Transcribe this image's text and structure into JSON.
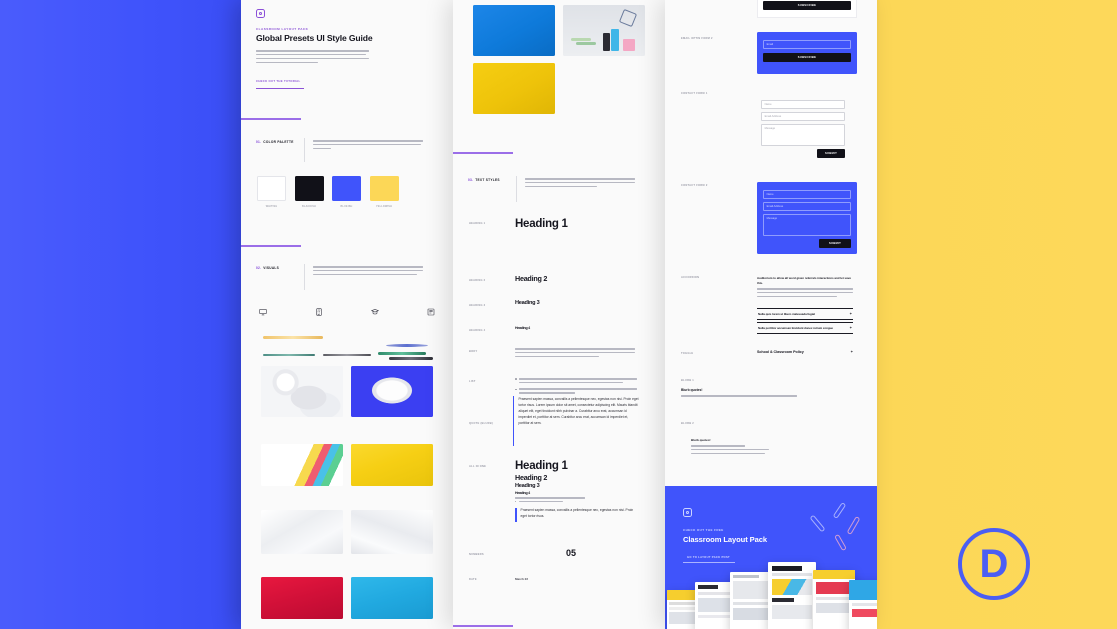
{
  "page": {
    "background_blue": "#4054FB",
    "background_yellow": "#FCD757",
    "sheet_background": "#FAFAFA"
  },
  "brand": {
    "logo_icon": "circle-in-rounded-square-icon",
    "divi_logo": "D",
    "divi_logo_name": "divi-logo"
  },
  "header": {
    "eyebrow": "Classroom Layout Pack",
    "title": "Global Presets UI Style Guide",
    "description": "This global presets style guide is a quick way to view a new and simple way of checking how to start creating this global preset. For a detailed manual on how to use this style guide, click on the link below or be referenced.",
    "cta_link": "Check out the tutorial"
  },
  "sections": {
    "color_palette": {
      "number": "01.",
      "title": "Color palette",
      "description": "In this first part of the style guide, you can find the color palette that's been used for this layout pack, and these colors make the default Divi palette of your Divi Theme Builder."
    },
    "visuals": {
      "number": "02.",
      "title": "Visuals",
      "description": "The second part of the style guide shows some of the visuals that are included inside this layout pack. By downloading the layout for your Divi Library, these visuals have automatically been added to your media library, ready for you to use."
    },
    "text_styles": {
      "number": "03.",
      "title": "Text styles",
      "description": "In this part of the style guide, you'll find the different text styles that were used throughout the layout pack. There is a separate preset for each heading style and a global preset with all text styles in one."
    }
  },
  "swatches": [
    {
      "name": "white-swatch",
      "hex": "#FFFFFF",
      "label": "Whitish"
    },
    {
      "name": "black-swatch",
      "hex": "#111118",
      "label": "Blackish"
    },
    {
      "name": "blue-swatch",
      "hex": "#4054FB",
      "label": "Blueish"
    },
    {
      "name": "yellow-swatch",
      "hex": "#FCD757",
      "label": "Yellowish"
    }
  ],
  "visual_icons": [
    "monitor-icon",
    "calculator-icon",
    "graduation-cap-icon",
    "book-icon"
  ],
  "text_style_rows": [
    {
      "label": "Heading 1",
      "sample": "Heading 1",
      "size": 11.5
    },
    {
      "label": "Heading 2",
      "sample": "Heading 2",
      "size": 7.2
    },
    {
      "label": "Heading 3",
      "sample": "Heading 3",
      "size": 5.6
    },
    {
      "label": "Heading 4",
      "sample": "Heading 4",
      "size": 3.6
    }
  ],
  "text_style_blocks": {
    "body_label": "Body",
    "list_label": "List",
    "quote_label": "Quote (blurb)",
    "all_in_one_label": "All in one",
    "numbers_label": "Numbers",
    "date_label": "Date",
    "numbers_value": "05",
    "date_value": "March 22",
    "quote_text": "Praesent sapien massa, convallis a pellentesque nec, egestas non nisi. Proin eget tortor risus. Lorem ipsum dolor sit amet, consectetur adipiscing elit. Mauris blandit aliquet elit, eget tincidunt nibh pulvinar a. Curabitur arcu erat, accumsan id imperdiet et, porttitor at sem. Curabitur arcu erat, accumsan id imperdiet et, porttitor at sem.",
    "quote_text_short": "Praesent sapien massa, convallis a pellentesque nec, egestas non nisi. Proin eget tortor risus."
  },
  "forms": {
    "email_optin_label": "Email optin form 1",
    "email_optin_blue_label": "Email optin form 2",
    "contact_form_label": "Contact form 1",
    "contact_form_blue_label": "Contact form 2",
    "email_placeholder": "Email",
    "subscribe_label": "Subscribe",
    "name_placeholder": "Name",
    "email_address_placeholder": "Email Address",
    "message_placeholder": "Message",
    "submit_label": "Submit"
  },
  "accordion": {
    "label": "Accordion",
    "items": [
      {
        "title": "Auditorium to allow all word given referrals interactions and let save this.",
        "open": true
      },
      {
        "title": "Nulla quis lorem ut libero malesuada fugiat",
        "open": false
      },
      {
        "title": "Nulla porttitor accumsan tincidunt donec rutrum congue",
        "open": false
      }
    ]
  },
  "toggle": {
    "label": "Toggle",
    "title": "School & Classroom Policy"
  },
  "blurbs": {
    "blurb_1_label": "Blurb 1",
    "blurb_1_title": "Blurb quotes!",
    "blurb_1_text": "Praesent sapien massa, convallis a pellentesque nec, egestas non nisi porttitor.",
    "blurb_2_label": "Blurb 2",
    "blurb_2_title": "Blurb quotes!",
    "blurb_2_text": "Praesent sapien massa, convallis a pellentesque nec, egestas non nisi porttitor ante ipsum."
  },
  "cta": {
    "eyebrow": "Check out the free",
    "title": "Classroom Layout Pack",
    "link": "Go to layout pack post",
    "logo_icon": "circle-in-rounded-square-icon"
  }
}
